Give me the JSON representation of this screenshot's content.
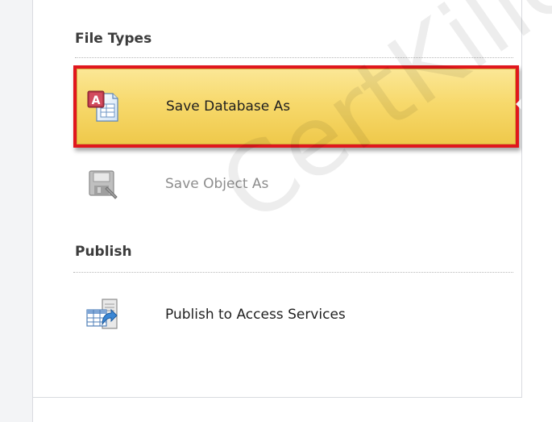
{
  "file_types": {
    "title": "File Types",
    "items": [
      {
        "label": "Save Database As",
        "icon": "access-database-icon",
        "state": "selected"
      },
      {
        "label": "Save Object As",
        "icon": "save-object-icon",
        "state": "disabled"
      }
    ]
  },
  "publish": {
    "title": "Publish",
    "items": [
      {
        "label": "Publish to Access Services",
        "icon": "publish-services-icon",
        "state": "normal"
      }
    ]
  },
  "watermark": "CertKiller",
  "colors": {
    "selection_highlight": "#f7d96c",
    "selection_border": "#e0171d",
    "access_red": "#a4373a"
  }
}
